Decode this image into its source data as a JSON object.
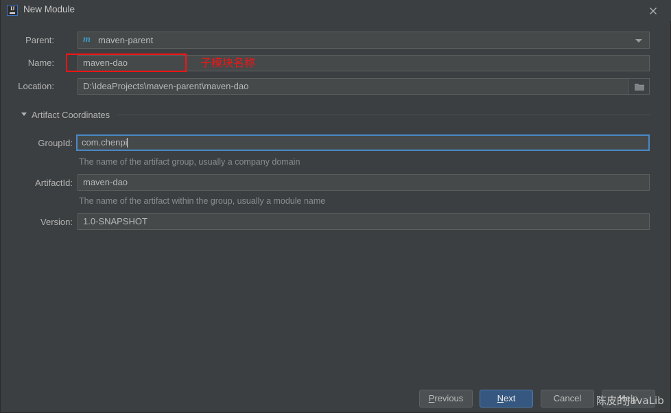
{
  "window": {
    "title": "New Module",
    "app_icon": "intellij-idea-icon",
    "close_icon": "close-icon"
  },
  "form": {
    "parent": {
      "label": "Parent:",
      "value": "maven-parent",
      "icon": "maven-module-icon",
      "dropdown_icon": "chevron-down-icon"
    },
    "name": {
      "label": "Name:",
      "value": "maven-dao"
    },
    "location": {
      "label": "Location:",
      "value": "D:\\IdeaProjects\\maven-parent\\maven-dao",
      "browse_icon": "folder-icon"
    }
  },
  "artifact_coordinates": {
    "title": "Artifact Coordinates",
    "collapse_icon": "triangle-down-icon",
    "group_id": {
      "label": "GroupId:",
      "value": "com.chenpi",
      "hint": "The name of the artifact group, usually a company domain",
      "focused": true
    },
    "artifact_id": {
      "label": "ArtifactId:",
      "value": "maven-dao",
      "hint": "The name of the artifact within the group, usually a module name"
    },
    "version": {
      "label": "Version:",
      "value": "1.0-SNAPSHOT"
    }
  },
  "annotation": {
    "text": "子模块名称",
    "color": "#f41414"
  },
  "buttons": {
    "previous": {
      "mnemonic": "P",
      "rest": "revious"
    },
    "next": {
      "mnemonic": "N",
      "rest": "ext"
    },
    "cancel": {
      "label": "Cancel"
    },
    "help": {
      "label": "Help"
    }
  },
  "watermark": {
    "text": "陈皮的JavaLib"
  },
  "colors": {
    "background": "#3c3f41",
    "field_background": "#45494a",
    "accent_primary": "#365880",
    "focus_border": "#4a88c7",
    "annotation_red": "#f41414",
    "maven_icon_blue": "#3d9ac7"
  }
}
